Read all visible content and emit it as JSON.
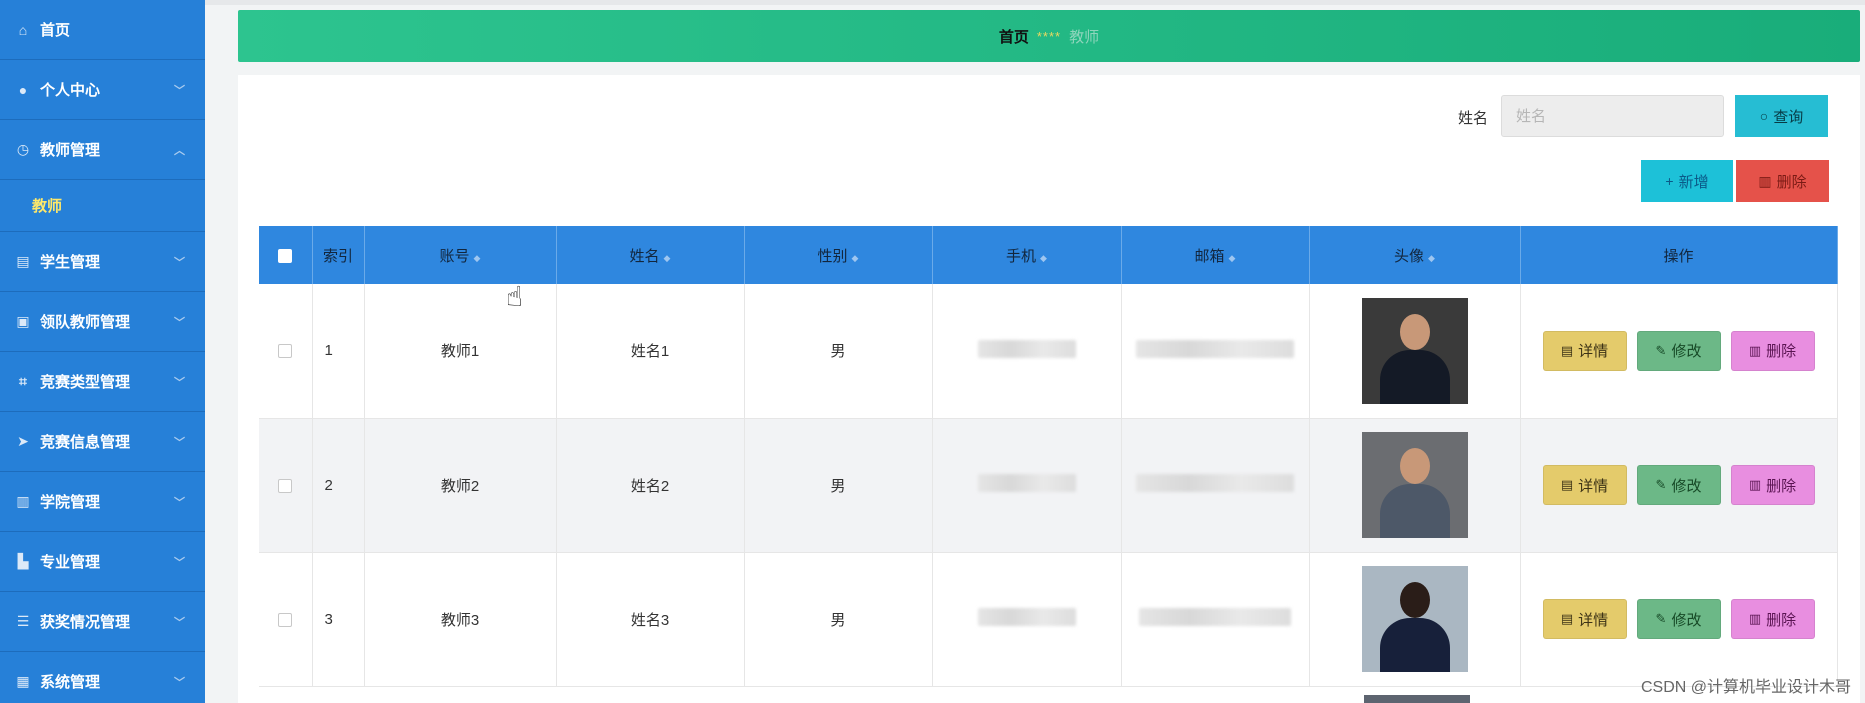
{
  "sidebar": {
    "items": [
      {
        "label": "首页",
        "icon": "home-icon",
        "has_chevron": false
      },
      {
        "label": "个人中心",
        "icon": "user-icon",
        "has_chevron": true
      },
      {
        "label": "教师管理",
        "icon": "clock-icon",
        "has_chevron": true,
        "expanded": true,
        "children": [
          {
            "label": "教师"
          }
        ]
      },
      {
        "label": "学生管理",
        "icon": "clipboard-icon",
        "has_chevron": true
      },
      {
        "label": "领队教师管理",
        "icon": "ticket-icon",
        "has_chevron": true
      },
      {
        "label": "竞赛类型管理",
        "icon": "crop-icon",
        "has_chevron": true
      },
      {
        "label": "竞赛信息管理",
        "icon": "send-icon",
        "has_chevron": true
      },
      {
        "label": "学院管理",
        "icon": "chart-icon",
        "has_chevron": true
      },
      {
        "label": "专业管理",
        "icon": "factory-icon",
        "has_chevron": true
      },
      {
        "label": "获奖情况管理",
        "icon": "list-icon",
        "has_chevron": true
      },
      {
        "label": "系统管理",
        "icon": "document-icon",
        "has_chevron": true
      }
    ]
  },
  "breadcrumb": {
    "home": "首页",
    "separator": "****",
    "current": "教师"
  },
  "search": {
    "label": "姓名",
    "placeholder": "姓名",
    "value": "",
    "query_button": "查询"
  },
  "toolbar": {
    "add_button": "新增",
    "delete_button": "删除"
  },
  "table": {
    "columns": [
      "索引",
      "账号",
      "姓名",
      "性别",
      "手机",
      "邮箱",
      "头像",
      "操作"
    ],
    "rows": [
      {
        "index": "1",
        "account": "教师1",
        "name": "姓名1",
        "gender": "男"
      },
      {
        "index": "2",
        "account": "教师2",
        "name": "姓名2",
        "gender": "男"
      },
      {
        "index": "3",
        "account": "教师3",
        "name": "姓名3",
        "gender": "男"
      }
    ],
    "actions": {
      "detail": "详情",
      "edit": "修改",
      "remove": "删除"
    }
  },
  "watermark": "CSDN @计算机毕业设计木哥",
  "colors": {
    "sidebar": "#2680d8",
    "breadcrumb": "#22b986",
    "table_header": "#2f87df",
    "detail": "#e4cb6b",
    "edit": "#6cb887",
    "remove": "#e88ee0",
    "submenu_active": "#ffe96a"
  }
}
